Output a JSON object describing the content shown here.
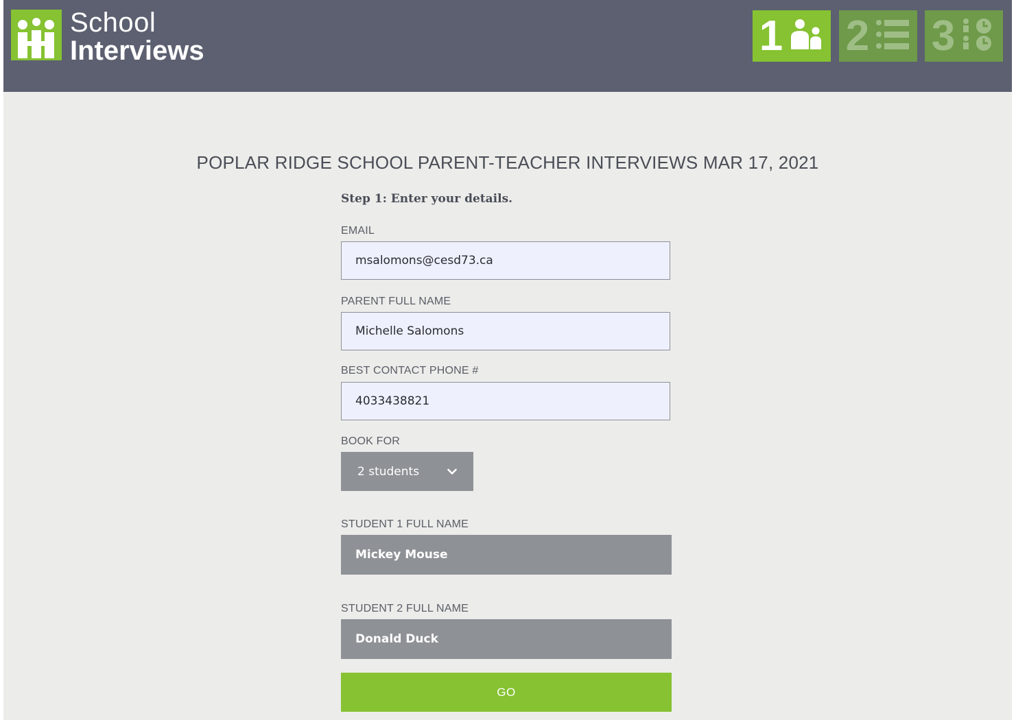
{
  "header": {
    "logo": {
      "line1": "School",
      "line2": "Interviews"
    },
    "steps": [
      {
        "number": "1",
        "icon": "people-icon",
        "state": "active"
      },
      {
        "number": "2",
        "icon": "list-icon",
        "state": "inactive"
      },
      {
        "number": "3",
        "icon": "schedule-icon",
        "state": "inactive"
      }
    ]
  },
  "page": {
    "title": "POPLAR RIDGE SCHOOL PARENT-TEACHER INTERVIEWS MAR 17, 2021",
    "step_label": "Step 1: Enter your details."
  },
  "form": {
    "email": {
      "label": "EMAIL",
      "value": "msalomons@cesd73.ca"
    },
    "parent_name": {
      "label": "PARENT FULL NAME",
      "value": "Michelle Salomons"
    },
    "phone": {
      "label": "BEST CONTACT PHONE #",
      "value": "4033438821"
    },
    "book_for": {
      "label": "BOOK FOR",
      "selected": "2 students"
    },
    "student1": {
      "label": "STUDENT 1 FULL NAME",
      "value": "Mickey Mouse"
    },
    "student2": {
      "label": "STUDENT 2 FULL NAME",
      "value": "Donald Duck"
    },
    "submit_label": "GO"
  },
  "colors": {
    "accent": "#86c232",
    "header": "#5c6070",
    "background": "#ececea",
    "field_dark": "#8e9196",
    "input_fill": "#eef0fd"
  }
}
